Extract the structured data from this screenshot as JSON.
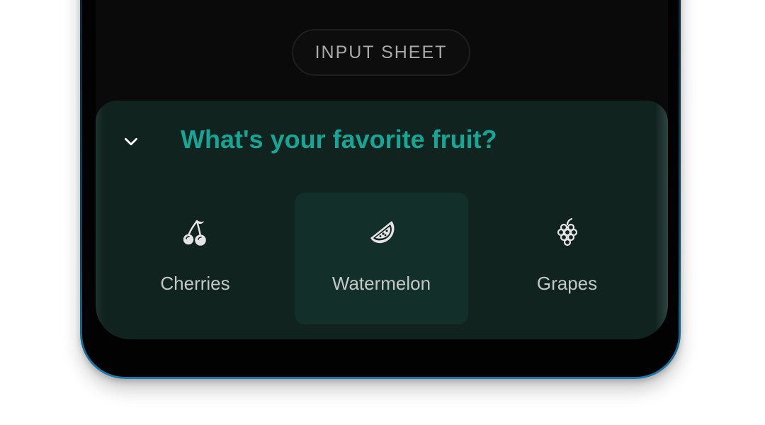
{
  "input_sheet_button": {
    "label": "INPUT SHEET"
  },
  "sheet": {
    "title": "What's your favorite fruit?",
    "collapse_icon": "chevron-down-icon",
    "options": [
      {
        "label": "Cherries",
        "icon": "cherries-icon",
        "selected": false
      },
      {
        "label": "Watermelon",
        "icon": "watermelon-icon",
        "selected": true
      },
      {
        "label": "Grapes",
        "icon": "grapes-icon",
        "selected": false
      }
    ]
  },
  "colors": {
    "title_accent": "#17a595",
    "sheet_background": "#10231f",
    "selected_option_background": "#132f2a",
    "option_text": "#c4c9c8",
    "screen_background": "#0a0a0a",
    "button_text": "#a9a9a9"
  }
}
